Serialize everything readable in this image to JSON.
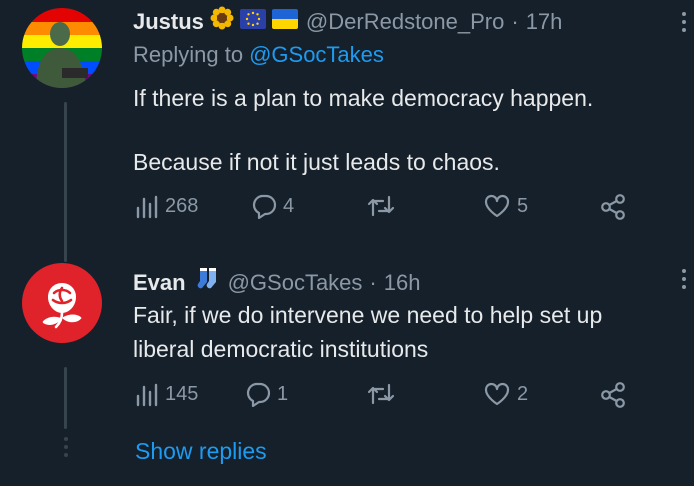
{
  "tweets": [
    {
      "name": "Justus",
      "handle": "@DerRedstone_Pro",
      "separator": "·",
      "time": "17h",
      "replying_prefix": "Replying to",
      "replying_to": "@GSocTakes",
      "text_line1": "If there is a plan to make democracy happen.",
      "text_line2": "Because if not it just leads to chaos.",
      "views": "268",
      "replies": "4",
      "retweets": "",
      "likes": "5",
      "badges": [
        "sunflower-icon",
        "eu-flag-icon",
        "ukraine-flag-icon"
      ]
    },
    {
      "name": "Evan",
      "handle": "@GSocTakes",
      "separator": "·",
      "time": "16h",
      "text_line1": "Fair, if we do intervene we need to help set up",
      "text_line2": "liberal democratic institutions",
      "views": "145",
      "replies": "1",
      "retweets": "",
      "likes": "2",
      "badges": [
        "socks-icon"
      ]
    }
  ],
  "show_replies": "Show replies",
  "colors": {
    "background": "#15202b",
    "accent": "#1d9bf0",
    "muted": "#8b98a5",
    "rose_avatar": "#e0232b"
  }
}
